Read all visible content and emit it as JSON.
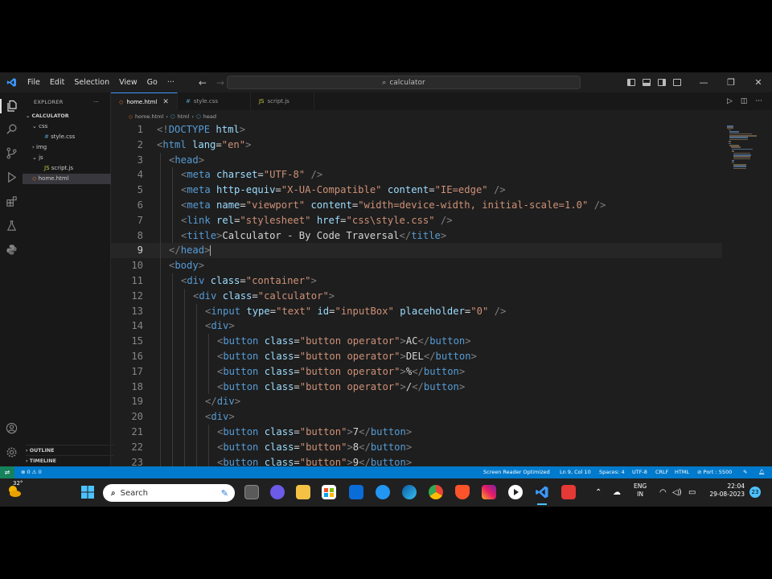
{
  "titlebar": {
    "menu": [
      "File",
      "Edit",
      "Selection",
      "View",
      "Go",
      "···"
    ],
    "search_text": "calculator",
    "window_controls": [
      "—",
      "❐",
      "✕"
    ]
  },
  "sidebar": {
    "header": "EXPLORER",
    "header_more": "···",
    "folder": "CALCULATOR",
    "tree": [
      {
        "name": "css",
        "type": "folder",
        "indent": 1
      },
      {
        "name": "style.css",
        "type": "file",
        "indent": 2
      },
      {
        "name": "img",
        "type": "folder",
        "indent": 1
      },
      {
        "name": "js",
        "type": "folder",
        "indent": 1
      },
      {
        "name": "script.js",
        "type": "file",
        "indent": 2
      },
      {
        "name": "home.html",
        "type": "file",
        "indent": 1,
        "selected": true
      }
    ],
    "outline_label": "OUTLINE",
    "timeline_label": "TIMELINE"
  },
  "tabs": [
    {
      "label": "home.html",
      "active": true,
      "close": "✕"
    },
    {
      "label": "style.css",
      "active": false
    },
    {
      "label": "script.js",
      "active": false
    }
  ],
  "breadcrumb": [
    "home.html",
    "html",
    "head"
  ],
  "editor": {
    "current_line": 9,
    "lines": [
      {
        "n": "1",
        "indent": 0,
        "code": [
          [
            "br",
            "<!"
          ],
          [
            "tag",
            "DOCTYPE"
          ],
          [
            "txt",
            " "
          ],
          [
            "attr",
            "html"
          ],
          [
            "br",
            ">"
          ]
        ]
      },
      {
        "n": "2",
        "indent": 0,
        "code": [
          [
            "br",
            "<"
          ],
          [
            "tag",
            "html"
          ],
          [
            "txt",
            " "
          ],
          [
            "attr",
            "lang"
          ],
          [
            "eq",
            "="
          ],
          [
            "str",
            "\"en\""
          ],
          [
            "br",
            ">"
          ]
        ]
      },
      {
        "n": "3",
        "indent": 1,
        "code": [
          [
            "br",
            "<"
          ],
          [
            "tag",
            "head"
          ],
          [
            "br",
            ">"
          ]
        ]
      },
      {
        "n": "4",
        "indent": 2,
        "code": [
          [
            "br",
            "<"
          ],
          [
            "tag",
            "meta"
          ],
          [
            "txt",
            " "
          ],
          [
            "attr",
            "charset"
          ],
          [
            "eq",
            "="
          ],
          [
            "str",
            "\"UTF-8\""
          ],
          [
            "txt",
            " "
          ],
          [
            "br",
            "/>"
          ]
        ]
      },
      {
        "n": "5",
        "indent": 2,
        "code": [
          [
            "br",
            "<"
          ],
          [
            "tag",
            "meta"
          ],
          [
            "txt",
            " "
          ],
          [
            "attr",
            "http-equiv"
          ],
          [
            "eq",
            "="
          ],
          [
            "str",
            "\"X-UA-Compatible\""
          ],
          [
            "txt",
            " "
          ],
          [
            "attr",
            "content"
          ],
          [
            "eq",
            "="
          ],
          [
            "str",
            "\"IE=edge\""
          ],
          [
            "txt",
            " "
          ],
          [
            "br",
            "/>"
          ]
        ]
      },
      {
        "n": "6",
        "indent": 2,
        "code": [
          [
            "br",
            "<"
          ],
          [
            "tag",
            "meta"
          ],
          [
            "txt",
            " "
          ],
          [
            "attr",
            "name"
          ],
          [
            "eq",
            "="
          ],
          [
            "str",
            "\"viewport\""
          ],
          [
            "txt",
            " "
          ],
          [
            "attr",
            "content"
          ],
          [
            "eq",
            "="
          ],
          [
            "str",
            "\"width=device-width, initial-scale=1.0\""
          ],
          [
            "txt",
            " "
          ],
          [
            "br",
            "/>"
          ]
        ]
      },
      {
        "n": "7",
        "indent": 2,
        "code": [
          [
            "br",
            "<"
          ],
          [
            "tag",
            "link"
          ],
          [
            "txt",
            " "
          ],
          [
            "attr",
            "rel"
          ],
          [
            "eq",
            "="
          ],
          [
            "str",
            "\"stylesheet\""
          ],
          [
            "txt",
            " "
          ],
          [
            "attr",
            "href"
          ],
          [
            "eq",
            "="
          ],
          [
            "str",
            "\"css\\style.css\""
          ],
          [
            "txt",
            " "
          ],
          [
            "br",
            "/>"
          ]
        ]
      },
      {
        "n": "8",
        "indent": 2,
        "code": [
          [
            "br",
            "<"
          ],
          [
            "tag",
            "title"
          ],
          [
            "br",
            ">"
          ],
          [
            "txt",
            "Calculator - By Code Traversal"
          ],
          [
            "br",
            "</"
          ],
          [
            "tag",
            "title"
          ],
          [
            "br",
            ">"
          ]
        ]
      },
      {
        "n": "9",
        "indent": 1,
        "code": [
          [
            "br",
            "</"
          ],
          [
            "tag",
            "head"
          ],
          [
            "br",
            ">"
          ]
        ]
      },
      {
        "n": "10",
        "indent": 1,
        "code": [
          [
            "br",
            "<"
          ],
          [
            "tag",
            "body"
          ],
          [
            "br",
            ">"
          ]
        ]
      },
      {
        "n": "11",
        "indent": 2,
        "code": [
          [
            "br",
            "<"
          ],
          [
            "tag",
            "div"
          ],
          [
            "txt",
            " "
          ],
          [
            "attr",
            "class"
          ],
          [
            "eq",
            "="
          ],
          [
            "str",
            "\"container\""
          ],
          [
            "br",
            ">"
          ]
        ]
      },
      {
        "n": "12",
        "indent": 3,
        "code": [
          [
            "br",
            "<"
          ],
          [
            "tag",
            "div"
          ],
          [
            "txt",
            " "
          ],
          [
            "attr",
            "class"
          ],
          [
            "eq",
            "="
          ],
          [
            "str",
            "\"calculator\""
          ],
          [
            "br",
            ">"
          ]
        ]
      },
      {
        "n": "13",
        "indent": 4,
        "code": [
          [
            "br",
            "<"
          ],
          [
            "tag",
            "input"
          ],
          [
            "txt",
            " "
          ],
          [
            "attr",
            "type"
          ],
          [
            "eq",
            "="
          ],
          [
            "str",
            "\"text\""
          ],
          [
            "txt",
            " "
          ],
          [
            "attr",
            "id"
          ],
          [
            "eq",
            "="
          ],
          [
            "str",
            "\"inputBox\""
          ],
          [
            "txt",
            " "
          ],
          [
            "attr",
            "placeholder"
          ],
          [
            "eq",
            "="
          ],
          [
            "str",
            "\"0\""
          ],
          [
            "txt",
            " "
          ],
          [
            "br",
            "/>"
          ]
        ]
      },
      {
        "n": "14",
        "indent": 4,
        "code": [
          [
            "br",
            "<"
          ],
          [
            "tag",
            "div"
          ],
          [
            "br",
            ">"
          ]
        ]
      },
      {
        "n": "15",
        "indent": 5,
        "code": [
          [
            "br",
            "<"
          ],
          [
            "tag",
            "button"
          ],
          [
            "txt",
            " "
          ],
          [
            "attr",
            "class"
          ],
          [
            "eq",
            "="
          ],
          [
            "str",
            "\"button operator\""
          ],
          [
            "br",
            ">"
          ],
          [
            "txt",
            "AC"
          ],
          [
            "br",
            "</"
          ],
          [
            "tag",
            "button"
          ],
          [
            "br",
            ">"
          ]
        ]
      },
      {
        "n": "16",
        "indent": 5,
        "code": [
          [
            "br",
            "<"
          ],
          [
            "tag",
            "button"
          ],
          [
            "txt",
            " "
          ],
          [
            "attr",
            "class"
          ],
          [
            "eq",
            "="
          ],
          [
            "str",
            "\"button operator\""
          ],
          [
            "br",
            ">"
          ],
          [
            "txt",
            "DEL"
          ],
          [
            "br",
            "</"
          ],
          [
            "tag",
            "button"
          ],
          [
            "br",
            ">"
          ]
        ]
      },
      {
        "n": "17",
        "indent": 5,
        "code": [
          [
            "br",
            "<"
          ],
          [
            "tag",
            "button"
          ],
          [
            "txt",
            " "
          ],
          [
            "attr",
            "class"
          ],
          [
            "eq",
            "="
          ],
          [
            "str",
            "\"button operator\""
          ],
          [
            "br",
            ">"
          ],
          [
            "txt",
            "%"
          ],
          [
            "br",
            "</"
          ],
          [
            "tag",
            "button"
          ],
          [
            "br",
            ">"
          ]
        ]
      },
      {
        "n": "18",
        "indent": 5,
        "code": [
          [
            "br",
            "<"
          ],
          [
            "tag",
            "button"
          ],
          [
            "txt",
            " "
          ],
          [
            "attr",
            "class"
          ],
          [
            "eq",
            "="
          ],
          [
            "str",
            "\"button operator\""
          ],
          [
            "br",
            ">"
          ],
          [
            "txt",
            "/"
          ],
          [
            "br",
            "</"
          ],
          [
            "tag",
            "button"
          ],
          [
            "br",
            ">"
          ]
        ]
      },
      {
        "n": "19",
        "indent": 4,
        "code": [
          [
            "br",
            "</"
          ],
          [
            "tag",
            "div"
          ],
          [
            "br",
            ">"
          ]
        ]
      },
      {
        "n": "20",
        "indent": 4,
        "code": [
          [
            "br",
            "<"
          ],
          [
            "tag",
            "div"
          ],
          [
            "br",
            ">"
          ]
        ]
      },
      {
        "n": "21",
        "indent": 5,
        "code": [
          [
            "br",
            "<"
          ],
          [
            "tag",
            "button"
          ],
          [
            "txt",
            " "
          ],
          [
            "attr",
            "class"
          ],
          [
            "eq",
            "="
          ],
          [
            "str",
            "\"button\""
          ],
          [
            "br",
            ">"
          ],
          [
            "txt",
            "7"
          ],
          [
            "br",
            "</"
          ],
          [
            "tag",
            "button"
          ],
          [
            "br",
            ">"
          ]
        ]
      },
      {
        "n": "22",
        "indent": 5,
        "code": [
          [
            "br",
            "<"
          ],
          [
            "tag",
            "button"
          ],
          [
            "txt",
            " "
          ],
          [
            "attr",
            "class"
          ],
          [
            "eq",
            "="
          ],
          [
            "str",
            "\"button\""
          ],
          [
            "br",
            ">"
          ],
          [
            "txt",
            "8"
          ],
          [
            "br",
            "</"
          ],
          [
            "tag",
            "button"
          ],
          [
            "br",
            ">"
          ]
        ]
      },
      {
        "n": "23",
        "indent": 5,
        "code": [
          [
            "br",
            "<"
          ],
          [
            "tag",
            "button"
          ],
          [
            "txt",
            " "
          ],
          [
            "attr",
            "class"
          ],
          [
            "eq",
            "="
          ],
          [
            "str",
            "\"button\""
          ],
          [
            "br",
            ">"
          ],
          [
            "txt",
            "9"
          ],
          [
            "br",
            "</"
          ],
          [
            "tag",
            "button"
          ],
          [
            "br",
            ">"
          ]
        ]
      }
    ]
  },
  "statusbar": {
    "problems": "⊗ 0 ⚠ 0",
    "screen_reader": "Screen Reader Optimized",
    "position": "Ln 9, Col 10",
    "spaces": "Spaces: 4",
    "encoding": "UTF-8",
    "eol": "CRLF",
    "language": "HTML",
    "port": "⊘ Port : 5500"
  },
  "taskbar": {
    "weather": "32°",
    "search_placeholder": "Search",
    "lang_line1": "ENG",
    "lang_line2": "IN",
    "time": "22:04",
    "date": "29-08-2023",
    "notification_count": "23"
  },
  "colors": {
    "accent": "#007acc",
    "tag": "#569cd6",
    "attribute": "#9cdcfe",
    "string": "#ce9178"
  }
}
